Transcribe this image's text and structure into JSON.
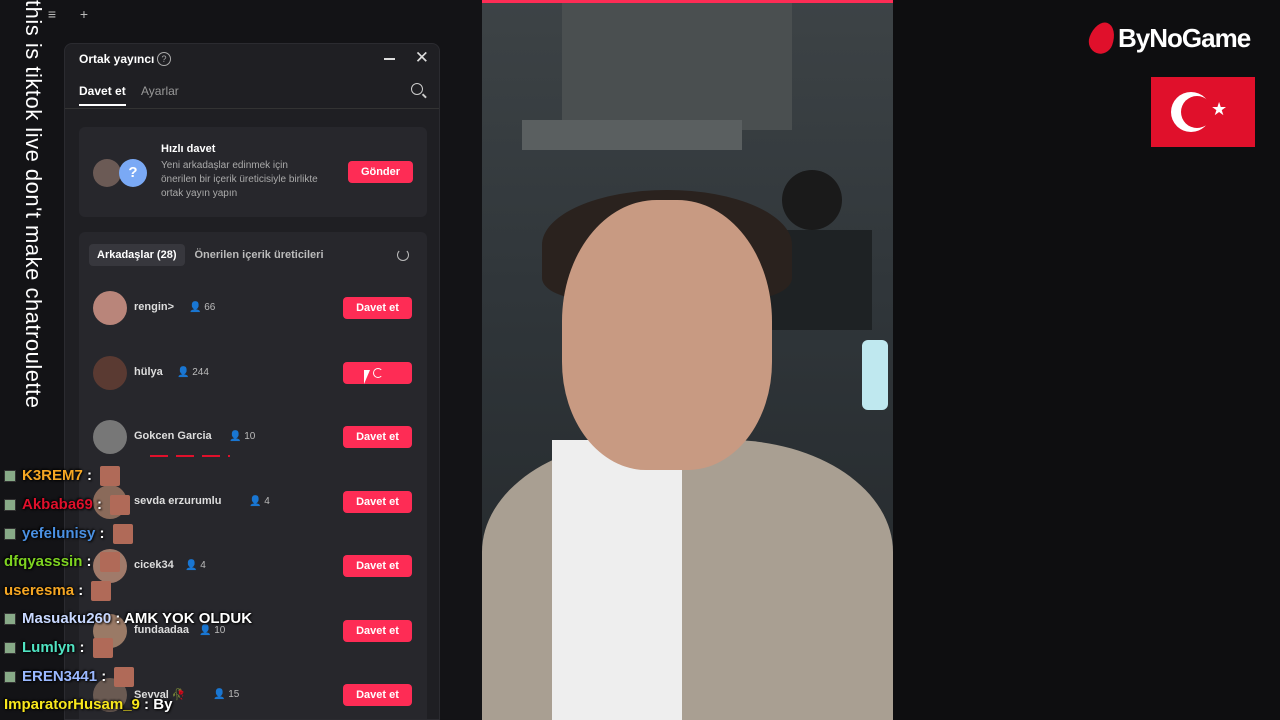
{
  "overlay": {
    "vertical_text": "this is tiktok live don't make chatroulette"
  },
  "panel": {
    "title": "Ortak yayıncı",
    "help_icon": "?",
    "close_icon": "✕",
    "tabs": [
      {
        "label": "Davet et",
        "active": true
      },
      {
        "label": "Ayarlar",
        "active": false
      }
    ]
  },
  "quick_invite": {
    "title": "Hızlı davet",
    "description": "Yeni arkadaşlar edinmek için önerilen bir içerik üreticisiyle birlikte ortak yayın yapın",
    "button": "Gönder",
    "avatar_question": "?"
  },
  "friends": {
    "tabs": [
      {
        "label": "Arkadaşlar (28)",
        "active": true
      },
      {
        "label": "Önerilen içerik üreticileri",
        "active": false
      }
    ],
    "items": [
      {
        "name": "rengin>",
        "count": "66",
        "button": "Davet et"
      },
      {
        "name": "hülya",
        "count": "244",
        "button": ""
      },
      {
        "name": "Gokcen Garcia",
        "count": "10",
        "button": "Davet et"
      },
      {
        "name": "sevda erzurumlu",
        "count": "4",
        "button": "Davet et"
      },
      {
        "name": "cicek34",
        "count": "4",
        "button": "Davet et"
      },
      {
        "name": "fundaadaa",
        "count": "10",
        "button": "Davet et"
      },
      {
        "name": "Sevval 🥀",
        "count": "15",
        "button": "Davet et"
      }
    ]
  },
  "chat": [
    {
      "user": "K3REM7",
      "color": "#f5a623",
      "message": ""
    },
    {
      "user": "Akbaba69",
      "color": "#e0102b",
      "message": ""
    },
    {
      "user": "yefelunisy",
      "color": "#4a90e2",
      "message": ""
    },
    {
      "user": "dfqyasssin",
      "color": "#7ed321",
      "message": ""
    },
    {
      "user": "useresma",
      "color": "#f5a623",
      "message": ""
    },
    {
      "user": "Masuaku260",
      "color": "#c8d8ff",
      "message": "AMK YOK OLDUK"
    },
    {
      "user": "Lumlyn",
      "color": "#50e3c2",
      "message": ""
    },
    {
      "user": "EREN3441",
      "color": "#9ab8ff",
      "message": ""
    },
    {
      "user": "ImparatorHusam_9",
      "color": "#f8e71c",
      "message": "By"
    }
  ],
  "brand": {
    "name": "ByNoGame"
  },
  "colors": {
    "accent": "#fe2c55",
    "panel_bg": "#1f1f23",
    "card_bg": "#27272c"
  }
}
